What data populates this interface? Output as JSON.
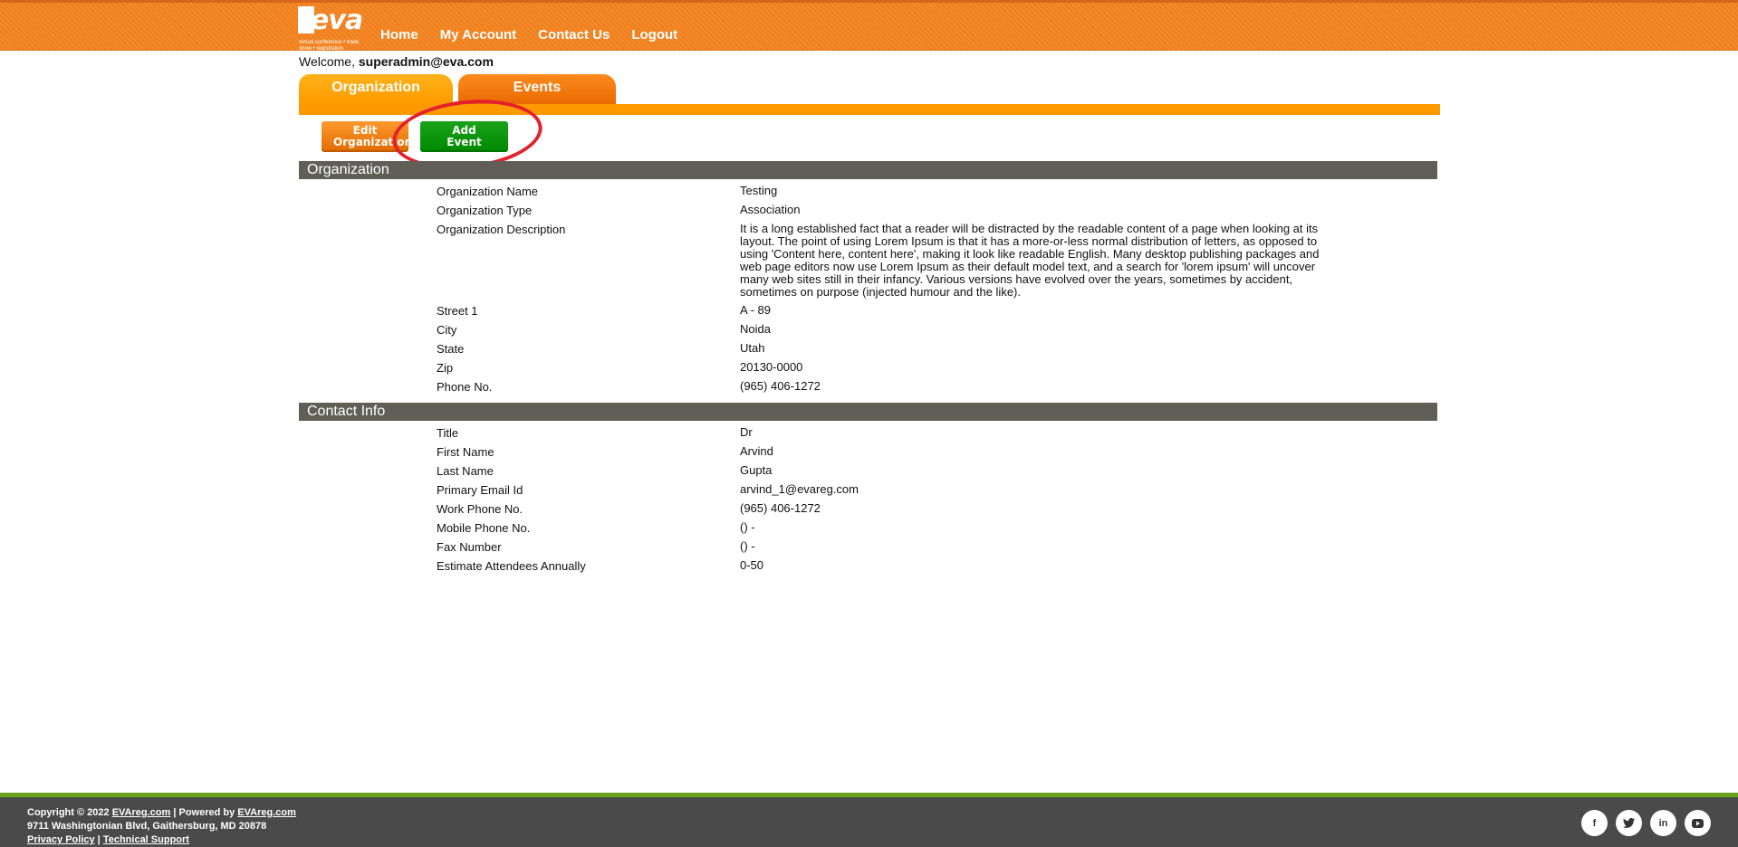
{
  "header": {
    "logo_text": "eva",
    "logo_tagline": "virtual conference • trade show • registration",
    "nav": [
      "Home",
      "My Account",
      "Contact Us",
      "Logout"
    ]
  },
  "welcome": {
    "prefix": "Welcome,",
    "user": "superadmin@eva.com"
  },
  "tabs": [
    "Organization",
    "Events"
  ],
  "buttons": {
    "edit": "Edit Organization",
    "add": "Add Event"
  },
  "organization": {
    "title": "Organization",
    "fields": [
      {
        "label": "Organization Name",
        "value": "Testing"
      },
      {
        "label": "Organization Type",
        "value": "Association"
      },
      {
        "label": "Organization Description",
        "value": "It is a long established fact that a reader will be distracted by the readable content of a page when looking at its layout. The point of using Lorem Ipsum is that it has a more-or-less normal distribution of letters, as opposed to using 'Content here, content here', making it look like readable English. Many desktop publishing packages and web page editors now use Lorem Ipsum as their default model text, and a search for 'lorem ipsum' will uncover many web sites still in their infancy. Various versions have evolved over the years, sometimes by accident, sometimes on purpose (injected humour and the like)."
      },
      {
        "label": "Street 1",
        "value": "A - 89"
      },
      {
        "label": "City",
        "value": "Noida"
      },
      {
        "label": "State",
        "value": "Utah"
      },
      {
        "label": "Zip",
        "value": "20130-0000"
      },
      {
        "label": "Phone No.",
        "value": "(965) 406-1272"
      }
    ]
  },
  "contact": {
    "title": "Contact Info",
    "fields": [
      {
        "label": "Title",
        "value": "Dr"
      },
      {
        "label": "First Name",
        "value": "Arvind"
      },
      {
        "label": "Last Name",
        "value": "Gupta"
      },
      {
        "label": "Primary Email Id",
        "value": "arvind_1@evareg.com"
      },
      {
        "label": "Work Phone No.",
        "value": "(965) 406-1272"
      },
      {
        "label": "Mobile Phone No.",
        "value": "() -"
      },
      {
        "label": "Fax Number",
        "value": "() -"
      },
      {
        "label": "Estimate Attendees Annually",
        "value": "0-50"
      }
    ]
  },
  "footer": {
    "copyright": "Copyright © 2022",
    "brand_link": "EVAreg.com",
    "powered_by": "| Powered by",
    "powered_link": "EVAreg.com",
    "address": "9711 Washingtonian Blvd, Gaithersburg, MD 20878",
    "privacy": "Privacy Policy",
    "separator": "|",
    "support": "Technical Support",
    "social_icons": [
      "facebook-icon",
      "twitter-icon",
      "linkedin-icon",
      "youtube-icon"
    ]
  }
}
